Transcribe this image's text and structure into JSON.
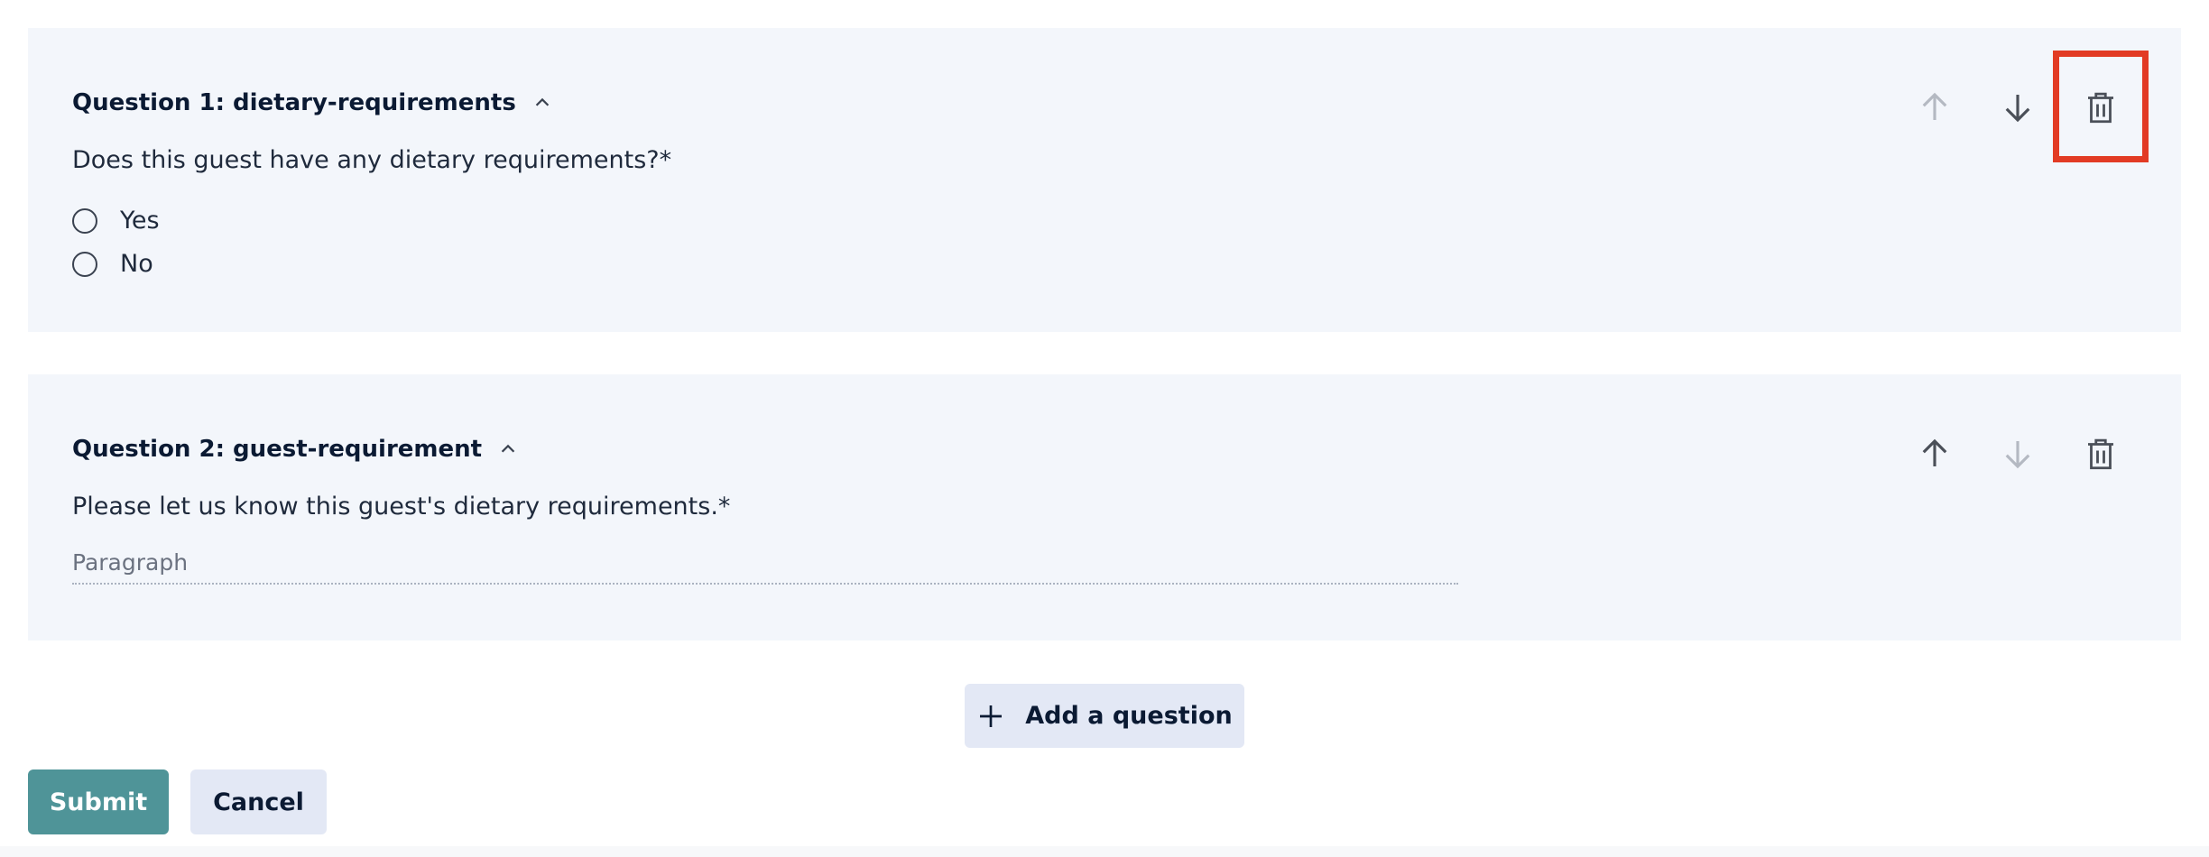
{
  "questions": [
    {
      "title": "Question 1: dietary-requirements",
      "prompt": "Does this guest have any dietary requirements?*",
      "options": [
        "Yes",
        "No"
      ],
      "move_up_enabled": false,
      "move_down_enabled": true
    },
    {
      "title": "Question 2: guest-requirement",
      "prompt": "Please let us know this guest's dietary requirements.*",
      "placeholder": "Paragraph",
      "move_up_enabled": true,
      "move_down_enabled": false
    }
  ],
  "actions": {
    "add_question": "Add a question",
    "submit": "Submit",
    "cancel": "Cancel"
  },
  "icons": {
    "collapse": "chevron-up-icon",
    "move_up": "arrow-up-icon",
    "move_down": "arrow-down-icon",
    "delete": "trash-icon",
    "add": "plus-icon"
  },
  "colors": {
    "card_bg": "#f3f6fb",
    "primary": "#4f9498",
    "secondary_btn": "#e3e8f5",
    "highlight": "#e23b24",
    "icon_enabled": "#4a4f58",
    "icon_disabled": "#b4b9c2"
  }
}
